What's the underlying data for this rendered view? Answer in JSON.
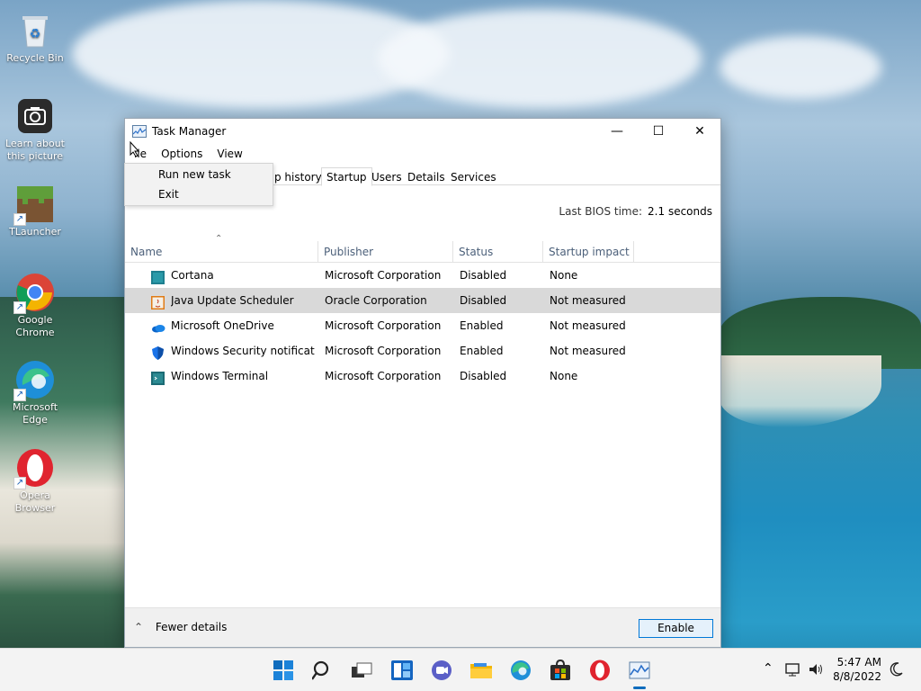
{
  "desktop": {
    "icons": [
      {
        "label": "Recycle Bin"
      },
      {
        "label": "Learn about this picture"
      },
      {
        "label": "TLauncher"
      },
      {
        "label": "Google Chrome"
      },
      {
        "label": "Microsoft Edge"
      },
      {
        "label": "Opera Browser"
      }
    ]
  },
  "window": {
    "title": "Task Manager",
    "controls": {
      "minimize": "—",
      "maximize": "☐",
      "close": "✕"
    },
    "menu": [
      "File",
      "Options",
      "View"
    ],
    "file_menu_visible_label": "ile",
    "dropdown": [
      "Run new task",
      "Exit"
    ],
    "tabs": [
      "p history",
      "Startup",
      "Users",
      "Details",
      "Services"
    ],
    "active_tab": "Startup",
    "bios": {
      "label": "Last BIOS time:",
      "value": "2.1 seconds"
    },
    "columns": [
      "Name",
      "Publisher",
      "Status",
      "Startup impact"
    ],
    "rows": [
      {
        "name": "Cortana",
        "publisher": "Microsoft Corporation",
        "status": "Disabled",
        "impact": "None",
        "icon": "cortana-icon"
      },
      {
        "name": "Java Update Scheduler",
        "publisher": "Oracle Corporation",
        "status": "Disabled",
        "impact": "Not measured",
        "icon": "java-icon"
      },
      {
        "name": "Microsoft OneDrive",
        "publisher": "Microsoft Corporation",
        "status": "Enabled",
        "impact": "Not measured",
        "icon": "onedrive-icon"
      },
      {
        "name": "Windows Security notificati...",
        "publisher": "Microsoft Corporation",
        "status": "Enabled",
        "impact": "Not measured",
        "icon": "shield-icon"
      },
      {
        "name": "Windows Terminal",
        "publisher": "Microsoft Corporation",
        "status": "Disabled",
        "impact": "None",
        "icon": "terminal-icon"
      }
    ],
    "selected_row": 1,
    "footer": {
      "fewer_details": "Fewer details",
      "enable_button": "Enable"
    }
  },
  "taskbar": {
    "clock_time": "5:47 AM",
    "clock_date": "8/8/2022",
    "apps": [
      "start-icon",
      "search-icon",
      "task-view-icon",
      "widgets-icon",
      "chat-icon",
      "file-explorer-icon",
      "edge-icon",
      "store-icon",
      "opera-icon",
      "task-manager-icon"
    ]
  },
  "colors": {
    "accent": "#0078d7",
    "selected_row": "#d9d9d9",
    "header_text": "#4c607a"
  }
}
